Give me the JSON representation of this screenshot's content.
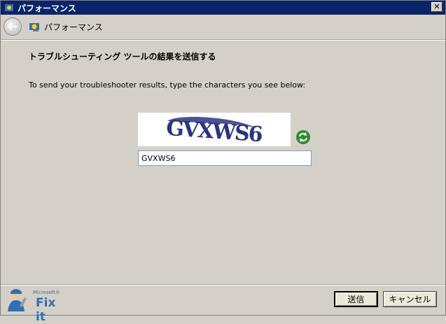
{
  "window": {
    "title": "パフォーマンス",
    "close_label": "✕"
  },
  "nav": {
    "title": "パフォーマンス"
  },
  "content": {
    "heading": "トラブルシューティング ツールの結果を送信する",
    "instruction": "To send your troubleshooter results, type the characters you see below:",
    "captcha_text": "GVXWS6",
    "input_value": "GVXWS6"
  },
  "footer": {
    "logo_ms": "Microsoft®",
    "logo_text": "Fix it",
    "send_label": "送信",
    "cancel_label": "キャンセル"
  },
  "colors": {
    "titlebar": "#0a246a",
    "captcha_ink": "#2a3580",
    "refresh_green": "#2e8b2e"
  }
}
